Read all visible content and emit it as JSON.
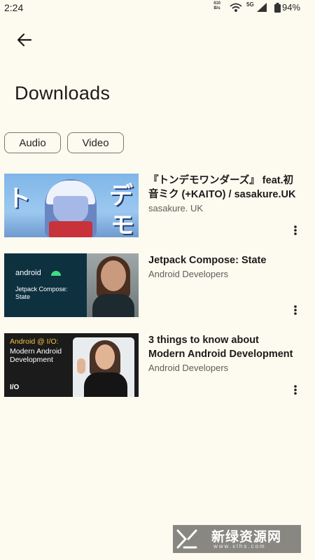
{
  "status_bar": {
    "time": "2:24",
    "net_speed_value": "410",
    "net_speed_unit": "B/s",
    "signal_label": "5G",
    "battery": "94%"
  },
  "header": {
    "title": "Downloads"
  },
  "filters": {
    "audio": "Audio",
    "video": "Video"
  },
  "videos": [
    {
      "title": "『トンデモワンダーズ』 feat.初音ミク (+KAITO) / sasakure.UK",
      "channel": "sasakure. UK"
    },
    {
      "title": "Jetpack Compose: State",
      "channel": "Android Developers"
    },
    {
      "title": "3 things to know about Modern Android Development",
      "channel": "Android Developers"
    }
  ],
  "thumbnails": {
    "t2_brand": "android",
    "t2_sub": "Jetpack Compose: State",
    "t3_brand": "Android @ I/O:",
    "t3_sub": "Modern Android Development",
    "t3_logo": "I/O"
  },
  "watermark": {
    "title": "新绿资源网",
    "url": "www.xlhs.com"
  },
  "icons": {
    "back": "arrow-back-icon",
    "more": "more-vert-icon",
    "wifi": "wifi-icon",
    "signal": "signal-icon",
    "battery": "battery-icon"
  }
}
